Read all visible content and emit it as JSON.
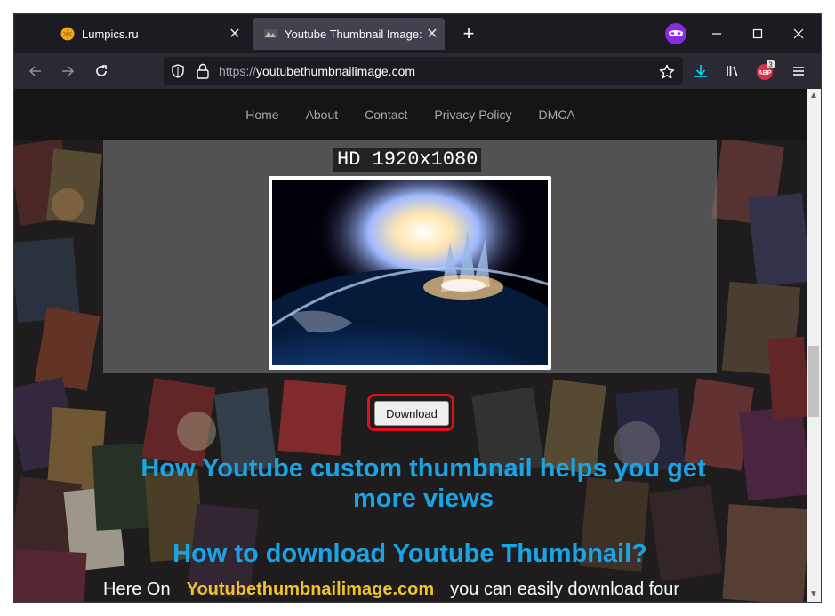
{
  "browser": {
    "tabs": [
      {
        "title": "Lumpics.ru",
        "active": false
      },
      {
        "title": "Youtube Thumbnail Image: Dow",
        "active": true
      }
    ],
    "new_tab_label": "+",
    "address": {
      "protocol": "https://",
      "domain": "youtubethumbnailimage.com"
    },
    "extension_badge": "3",
    "extension_label": "ABP"
  },
  "site": {
    "nav": [
      "Home",
      "About",
      "Contact",
      "Privacy Policy",
      "DMCA"
    ],
    "resolution_label": "HD 1920x1080",
    "download_label": "Download",
    "heading1": "How Youtube custom thumbnail helps you get more views",
    "heading2": "How to download Youtube Thumbnail?",
    "para_start": "Here On",
    "para_brand": "Youtubethumbnailimage.com",
    "para_end": "you can easily download four"
  },
  "colors": {
    "accent_blue": "#1aa4e6",
    "brand_yellow": "#f2c12e",
    "highlight_red": "#e0101e"
  }
}
